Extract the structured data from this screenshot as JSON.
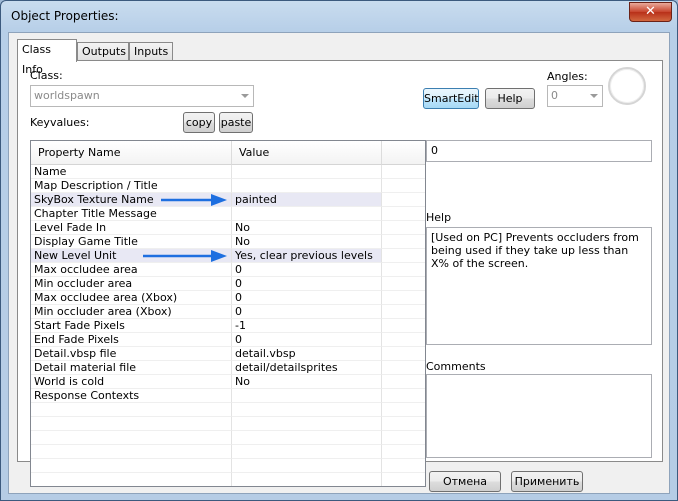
{
  "window": {
    "title": "Object Properties:",
    "close_glyph": "✕"
  },
  "tabs": [
    {
      "label": "Class Info"
    },
    {
      "label": "Outputs"
    },
    {
      "label": "Inputs"
    }
  ],
  "class_label": "Class:",
  "class_value": "worldspawn",
  "keyvalues_label": "Keyvalues:",
  "copy_label": "copy",
  "paste_label": "paste",
  "smartedit_label": "SmartEdit",
  "help_button_label": "Help",
  "angles_label": "Angles:",
  "angles_value": "0",
  "grid": {
    "headers": [
      "Property Name",
      "Value"
    ],
    "rows": [
      {
        "name": "Name",
        "value": ""
      },
      {
        "name": "Map Description / Title",
        "value": ""
      },
      {
        "name": "SkyBox Texture Name",
        "value": "painted",
        "selected": true
      },
      {
        "name": "Chapter Title Message",
        "value": ""
      },
      {
        "name": "Level Fade In",
        "value": "No"
      },
      {
        "name": "Display Game Title",
        "value": "No"
      },
      {
        "name": "New Level Unit",
        "value": "Yes, clear previous levels",
        "selected": true
      },
      {
        "name": "Max occludee area",
        "value": "0"
      },
      {
        "name": "Min occluder area",
        "value": "0"
      },
      {
        "name": "Max occludee area (Xbox)",
        "value": "0"
      },
      {
        "name": "Min occluder area (Xbox)",
        "value": "0"
      },
      {
        "name": "Start Fade Pixels",
        "value": "-1"
      },
      {
        "name": "End Fade Pixels",
        "value": "0"
      },
      {
        "name": "Detail.vbsp file",
        "value": "detail.vbsp"
      },
      {
        "name": "Detail material file",
        "value": "detail/detailsprites"
      },
      {
        "name": "World is cold",
        "value": "No"
      },
      {
        "name": "Response Contexts",
        "value": ""
      }
    ]
  },
  "value_field": "0",
  "help_section_label": "Help",
  "help_text": "[Used on PC] Prevents occluders from being used if they take up less than X% of the screen.",
  "comments_label": "Comments",
  "comments_text": "",
  "cancel_label": "Отмена",
  "apply_label": "Применить",
  "colors": {
    "annotation_arrow": "#1e6fe0",
    "title_bar": "#b7cfe8",
    "close_button": "#c7432c"
  }
}
